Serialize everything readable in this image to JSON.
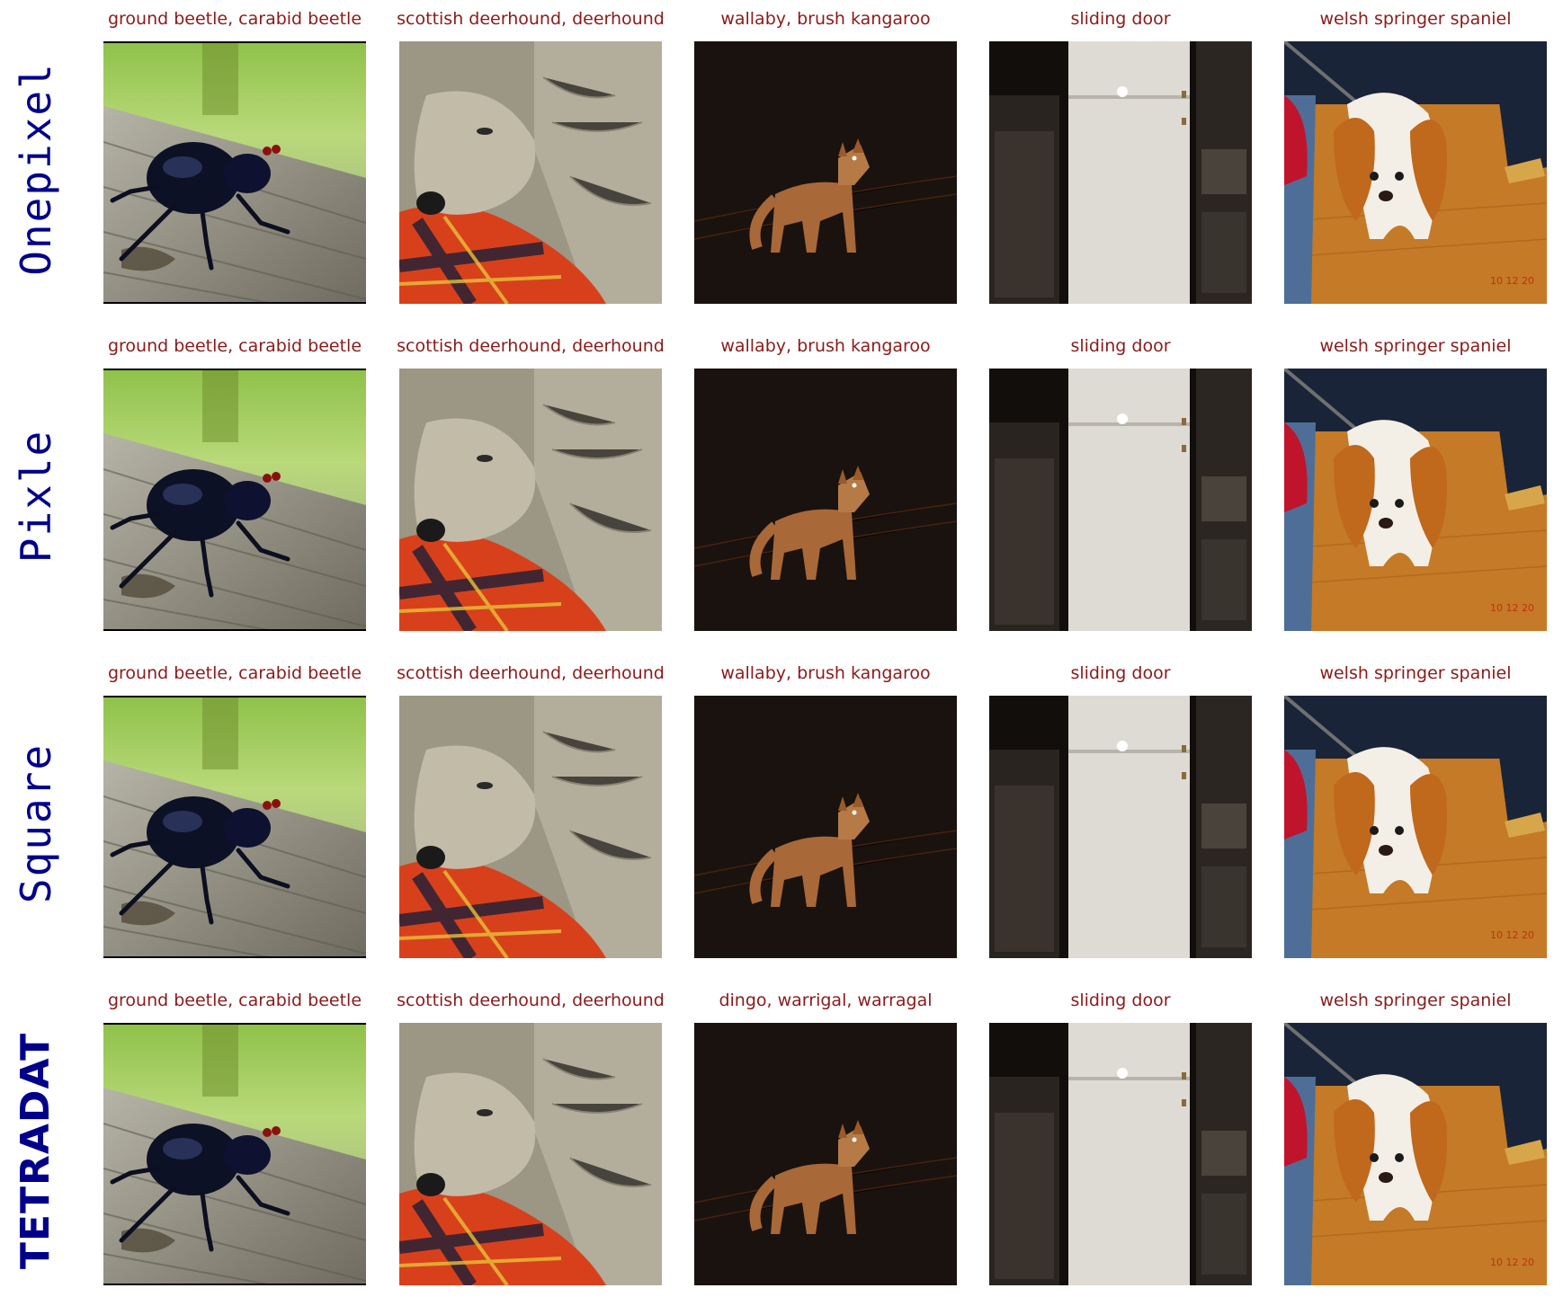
{
  "rows": [
    {
      "method": "Onepixel",
      "captions": [
        "ground beetle, carabid beetle",
        "scottish deerhound, deerhound",
        "wallaby, brush kangaroo",
        "sliding door",
        "welsh springer spaniel"
      ],
      "images": [
        "beetle on wooden plank",
        "grey wolfhound on red plaid blanket",
        "fox at night",
        "white refrigerator in dark cabinet",
        "spaniel on wooden floor with leash"
      ]
    },
    {
      "method": "Pixle",
      "captions": [
        "ground beetle, carabid beetle",
        "scottish deerhound, deerhound",
        "wallaby, brush kangaroo",
        "sliding door",
        "welsh springer spaniel"
      ],
      "images": [
        "beetle on wooden plank",
        "grey wolfhound on red plaid blanket",
        "fox at night",
        "white refrigerator in dark cabinet",
        "spaniel on wooden floor with leash"
      ]
    },
    {
      "method": "Square",
      "captions": [
        "ground beetle, carabid beetle",
        "scottish deerhound, deerhound",
        "wallaby, brush kangaroo",
        "sliding door",
        "welsh springer spaniel"
      ],
      "images": [
        "beetle on wooden plank",
        "grey wolfhound on red plaid blanket",
        "fox at night",
        "white refrigerator in dark cabinet",
        "spaniel on wooden floor with leash"
      ]
    },
    {
      "method": "TETRADAT",
      "captions": [
        "ground beetle, carabid beetle",
        "scottish deerhound, deerhound",
        "dingo, warrigal, warragal",
        "sliding door",
        "welsh springer spaniel"
      ],
      "images": [
        "beetle on wooden plank",
        "grey wolfhound on red plaid blanket",
        "fox at night",
        "white refrigerator in dark cabinet",
        "spaniel on wooden floor with leash"
      ]
    }
  ],
  "image_watermark": "10 12 20",
  "colors": {
    "method_label": "#00008b",
    "caption": "#8b1a1a"
  }
}
